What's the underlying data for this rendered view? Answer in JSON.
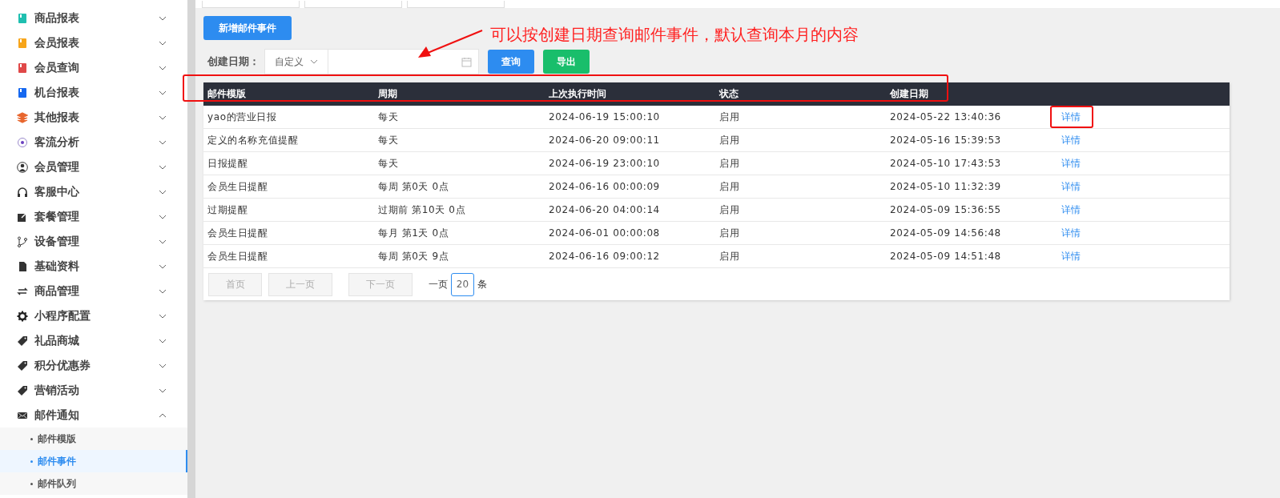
{
  "sidebar": {
    "items": [
      {
        "label": "商品报表",
        "expanded": false
      },
      {
        "label": "会员报表",
        "expanded": false
      },
      {
        "label": "会员查询",
        "expanded": false
      },
      {
        "label": "机台报表",
        "expanded": false
      },
      {
        "label": "其他报表",
        "expanded": false
      },
      {
        "label": "客流分析",
        "expanded": false
      },
      {
        "label": "会员管理",
        "expanded": false
      },
      {
        "label": "客服中心",
        "expanded": false
      },
      {
        "label": "套餐管理",
        "expanded": false
      },
      {
        "label": "设备管理",
        "expanded": false
      },
      {
        "label": "基础资料",
        "expanded": false
      },
      {
        "label": "商品管理",
        "expanded": false
      },
      {
        "label": "小程序配置",
        "expanded": false
      },
      {
        "label": "礼品商城",
        "expanded": false
      },
      {
        "label": "积分优惠券",
        "expanded": false
      },
      {
        "label": "营销活动",
        "expanded": false
      },
      {
        "label": "邮件通知",
        "expanded": true,
        "children": [
          {
            "label": "邮件模版",
            "selected": false
          },
          {
            "label": "邮件事件",
            "selected": true
          },
          {
            "label": "邮件队列",
            "selected": false
          }
        ]
      }
    ]
  },
  "toolbar": {
    "add_button": "新增邮件事件"
  },
  "filter": {
    "label": "创建日期：",
    "mode": "自定义",
    "query_button": "查询",
    "export_button": "导出"
  },
  "table": {
    "columns": [
      "邮件模版",
      "周期",
      "上次执行时间",
      "状态",
      "创建日期"
    ],
    "rows": [
      {
        "cells": [
          "yao的营业日报",
          "每天",
          "2024-06-19 15:00:10",
          "启用",
          "2024-05-22 13:40:36"
        ],
        "action": "详情"
      },
      {
        "cells": [
          "定义的名称充值提醒",
          "每天",
          "2024-06-20 09:00:11",
          "启用",
          "2024-05-16 15:39:53"
        ],
        "action": "详情"
      },
      {
        "cells": [
          "日报提醒",
          "每天",
          "2024-06-19 23:00:10",
          "启用",
          "2024-05-10 17:43:53"
        ],
        "action": "详情"
      },
      {
        "cells": [
          "会员生日提醒",
          "每周 第0天 0点",
          "2024-06-16 00:00:09",
          "启用",
          "2024-05-10 11:32:39"
        ],
        "action": "详情"
      },
      {
        "cells": [
          "过期提醒",
          "过期前 第10天 0点",
          "2024-06-20 04:00:14",
          "启用",
          "2024-05-09 15:36:55"
        ],
        "action": "详情"
      },
      {
        "cells": [
          "会员生日提醒",
          "每月 第1天 0点",
          "2024-06-01 00:00:08",
          "启用",
          "2024-05-09 14:56:48"
        ],
        "action": "详情"
      },
      {
        "cells": [
          "会员生日提醒",
          "每周 第0天 9点",
          "2024-06-16 09:00:12",
          "启用",
          "2024-05-09 14:51:48"
        ],
        "action": "详情"
      }
    ]
  },
  "pagination": {
    "buttons": [
      {
        "label": "首页",
        "disabled": true
      },
      {
        "label": "上一页",
        "disabled": true
      },
      {
        "label": "下一页",
        "disabled": true
      }
    ],
    "per_page_prefix": "一页",
    "per_page": "20",
    "per_page_suffix": "条"
  },
  "annotation": {
    "text": "可以按创建日期查询邮件事件，默认查询本月的内容"
  }
}
